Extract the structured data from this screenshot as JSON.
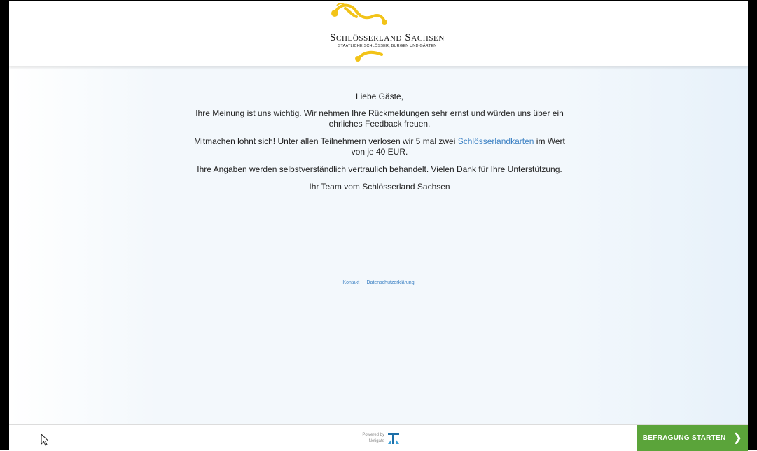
{
  "brand": {
    "title": "Schlösserland Sachsen",
    "subtitle": "STAATLICHE SCHLÖSSER, BURGEN UND GÄRTEN",
    "logo_color": "#f2c318"
  },
  "intro": {
    "greeting": "Liebe Gäste,",
    "p1": "Ihre Meinung ist uns wichtig. Wir nehmen Ihre Rückmeldungen sehr ernst und würden uns über ein ehrliches Feedback freuen.",
    "p2_before": "Mitmachen lohnt sich! Unter allen Teilnehmern verlosen wir 5 mal zwei ",
    "p2_link": "Schlösserlandkarten",
    "p2_after": " im Wert von je 40 EUR.",
    "p3": "Ihre Angaben werden selbstverständlich vertraulich behandelt. Vielen Dank für Ihre Unterstützung.",
    "signature": "Ihr Team vom Schlösserland Sachsen",
    "link_color": "#3d82c4"
  },
  "legal": {
    "contact": "Kontakt",
    "separator": "·",
    "privacy": "Datenschutzerklärung"
  },
  "footer": {
    "powered_by": "Powered by",
    "vendor": "Netigate",
    "start_button": "BEFRAGUNG STARTEN",
    "start_icon": "chevron-right-icon",
    "button_color": "#5ba43a"
  }
}
